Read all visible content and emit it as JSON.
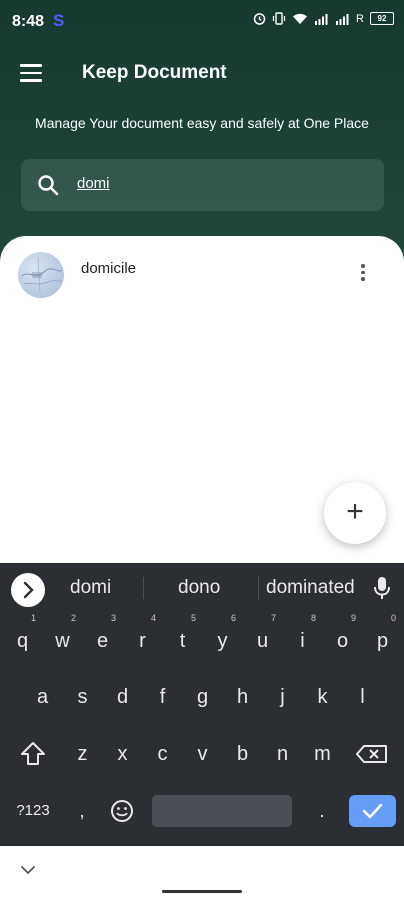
{
  "status_bar": {
    "time": "8:48",
    "app_indicator": "S",
    "network_label": "R",
    "battery": "92",
    "icons": [
      "alarm-icon",
      "vibrate-icon",
      "wifi-icon",
      "signal-icon",
      "signal-icon",
      "battery-icon"
    ]
  },
  "app_bar": {
    "title": "Keep Document",
    "menu_icon": "hamburger-menu-icon"
  },
  "subtitle": "Manage Your document easy and safely at One Place",
  "search": {
    "value": "domi",
    "icon": "search-icon"
  },
  "documents": [
    {
      "name": "domicile",
      "thumbnail": "map-thumbnail"
    }
  ],
  "fab_label": "+",
  "keyboard": {
    "suggestions": [
      "domi",
      "dono",
      "dominated"
    ],
    "row1": [
      {
        "k": "q",
        "h": "1"
      },
      {
        "k": "w",
        "h": "2"
      },
      {
        "k": "e",
        "h": "3"
      },
      {
        "k": "r",
        "h": "4"
      },
      {
        "k": "t",
        "h": "5"
      },
      {
        "k": "y",
        "h": "6"
      },
      {
        "k": "u",
        "h": "7"
      },
      {
        "k": "i",
        "h": "8"
      },
      {
        "k": "o",
        "h": "9"
      },
      {
        "k": "p",
        "h": "0"
      }
    ],
    "row2": [
      "a",
      "s",
      "d",
      "f",
      "g",
      "h",
      "j",
      "k",
      "l"
    ],
    "row3": [
      "z",
      "x",
      "c",
      "v",
      "b",
      "n",
      "m"
    ],
    "symbols_label": "?123",
    "comma_label": ",",
    "period_label": "."
  },
  "colors": {
    "header_bg": "#21473c",
    "keyboard_bg": "#2b2f33",
    "enter_key": "#669df6",
    "indicator_s": "#4d5cff"
  }
}
